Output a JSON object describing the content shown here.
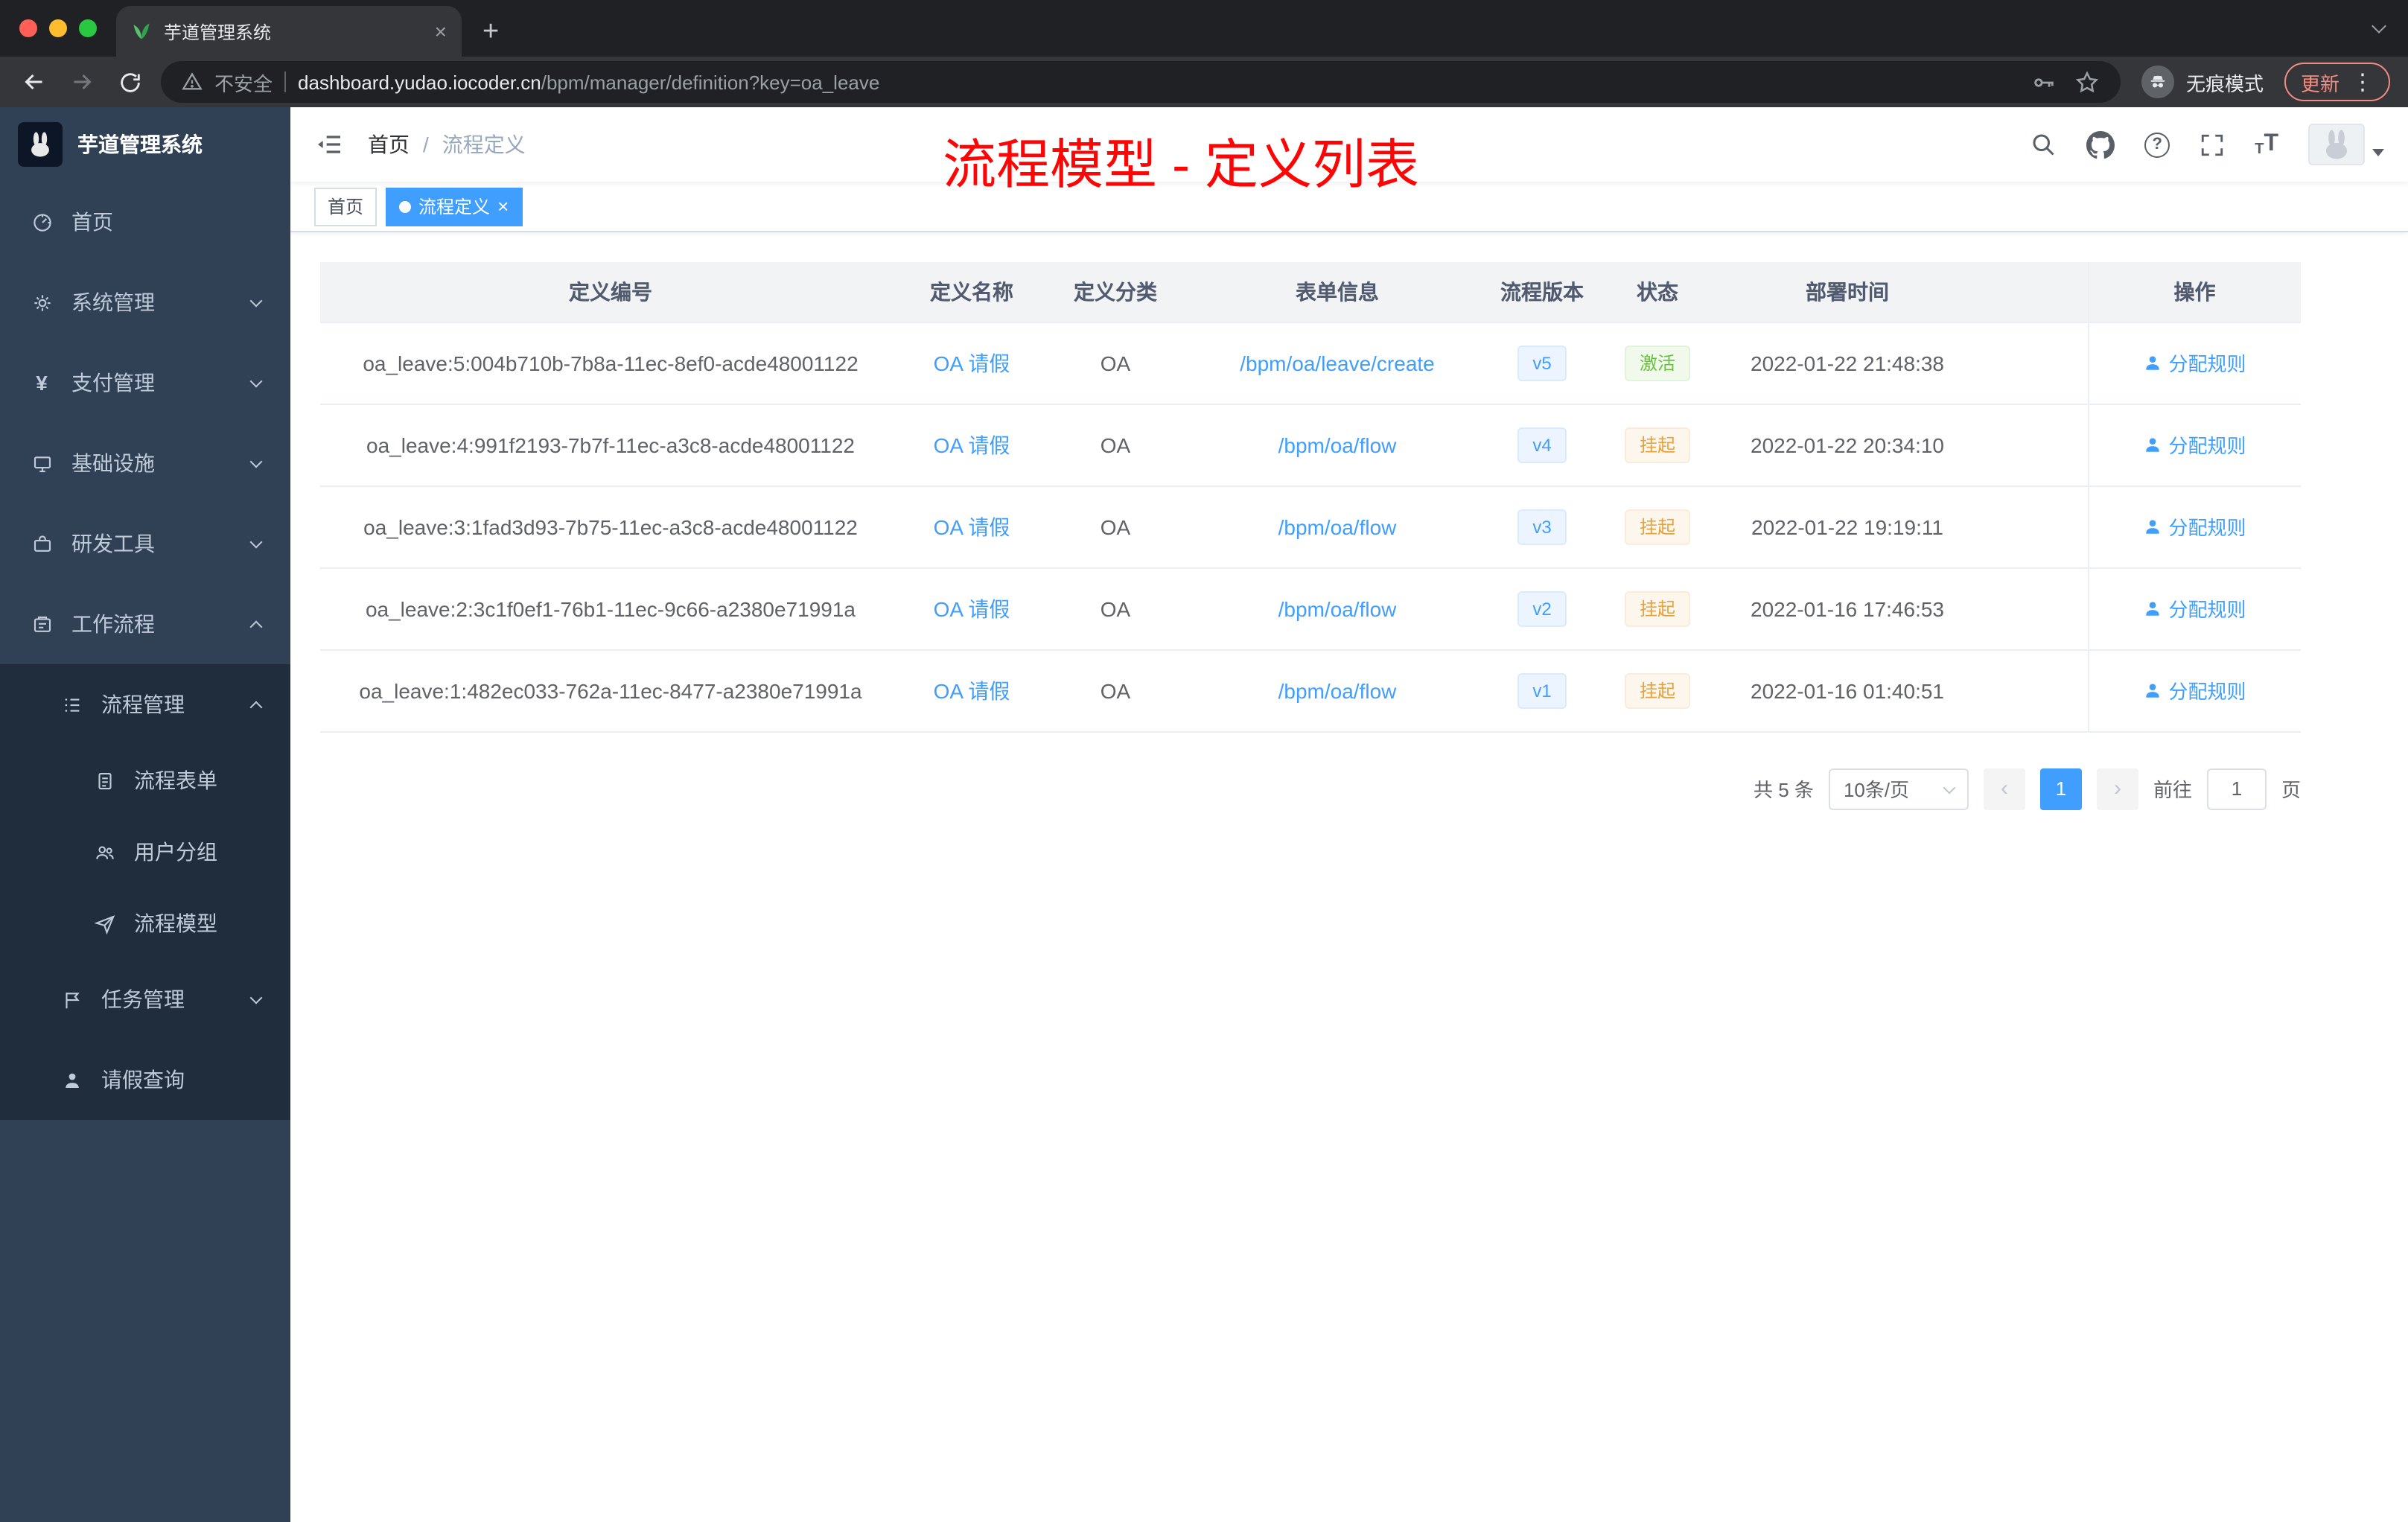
{
  "colors": {
    "accent": "#409eff",
    "annotation_red": "#fe0505",
    "sidebar_bg": "#304156",
    "submenu_bg": "#1f2d3d",
    "status_active": "#67c23a",
    "status_suspended": "#e6a23c",
    "update_chip": "#f28b82"
  },
  "glyphs": {
    "close": "×",
    "plus": "+",
    "prev": "‹",
    "next": "›",
    "question": "?",
    "kebab": "⋮",
    "t": "T",
    "yen": "¥"
  },
  "browser": {
    "tab_title": "芋道管理系统",
    "security": "不安全",
    "host": "dashboard.yudao.iocoder.cn",
    "path": "/bpm/manager/definition?key=oa_leave",
    "incognito": "无痕模式",
    "update": "更新"
  },
  "sidebar": {
    "logo": "芋道管理系统",
    "items": [
      {
        "label": "首页"
      },
      {
        "label": "系统管理"
      },
      {
        "label": "支付管理"
      },
      {
        "label": "基础设施"
      },
      {
        "label": "研发工具"
      },
      {
        "label": "工作流程"
      }
    ],
    "process_group": {
      "label": "流程管理"
    },
    "process_children": [
      {
        "label": "流程表单"
      },
      {
        "label": "用户分组"
      },
      {
        "label": "流程模型"
      }
    ],
    "task_group": {
      "label": "任务管理"
    },
    "leave_item": {
      "label": "请假查询"
    }
  },
  "breadcrumb": {
    "home": "首页",
    "sep": "/",
    "current": "流程定义"
  },
  "annotation": {
    "text": "流程模型 - 定义列表"
  },
  "tags": {
    "home": {
      "label": "首页"
    },
    "active": {
      "label": "流程定义"
    }
  },
  "table": {
    "columns": [
      "定义编号",
      "定义名称",
      "定义分类",
      "表单信息",
      "流程版本",
      "状态",
      "部署时间",
      "操作"
    ],
    "action_label": "分配规则",
    "rows": [
      {
        "id": "oa_leave:5:004b710b-7b8a-11ec-8ef0-acde48001122",
        "name": "OA 请假",
        "category": "OA",
        "form": "/bpm/oa/leave/create",
        "version": "v5",
        "status": "激活",
        "time": "2022-01-22 21:48:38"
      },
      {
        "id": "oa_leave:4:991f2193-7b7f-11ec-a3c8-acde48001122",
        "name": "OA 请假",
        "category": "OA",
        "form": "/bpm/oa/flow",
        "version": "v4",
        "status": "挂起",
        "time": "2022-01-22 20:34:10"
      },
      {
        "id": "oa_leave:3:1fad3d93-7b75-11ec-a3c8-acde48001122",
        "name": "OA 请假",
        "category": "OA",
        "form": "/bpm/oa/flow",
        "version": "v3",
        "status": "挂起",
        "time": "2022-01-22 19:19:11"
      },
      {
        "id": "oa_leave:2:3c1f0ef1-76b1-11ec-9c66-a2380e71991a",
        "name": "OA 请假",
        "category": "OA",
        "form": "/bpm/oa/flow",
        "version": "v2",
        "status": "挂起",
        "time": "2022-01-16 17:46:53"
      },
      {
        "id": "oa_leave:1:482ec033-762a-11ec-8477-a2380e71991a",
        "name": "OA 请假",
        "category": "OA",
        "form": "/bpm/oa/flow",
        "version": "v1",
        "status": "挂起",
        "time": "2022-01-16 01:40:51"
      }
    ]
  },
  "pagination": {
    "total": "共 5 条",
    "page_size": "10条/页",
    "page": "1",
    "goto_label": "前往",
    "goto_value": "1",
    "page_unit": "页"
  }
}
